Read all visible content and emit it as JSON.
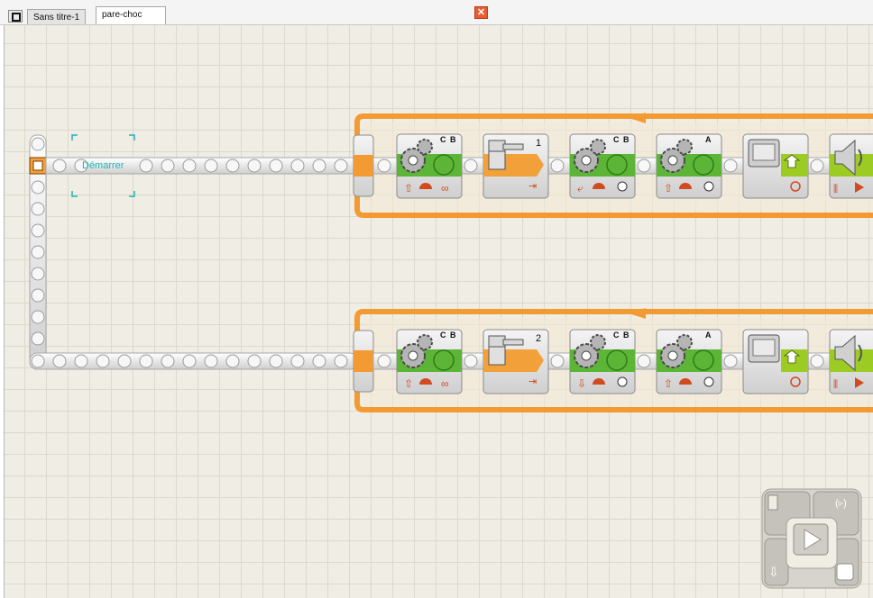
{
  "tabs": [
    {
      "label": "Sans titre-1"
    },
    {
      "label": "pare-choc"
    }
  ],
  "comment": {
    "text": "Démarrer"
  },
  "row1": {
    "motor1_ports": "C B",
    "sensor_port": "1",
    "motor2_ports": "C B",
    "motor3_ports": "A"
  },
  "row2": {
    "motor1_ports": "C B",
    "sensor_port": "2",
    "motor2_ports": "C B",
    "motor3_ports": "A"
  },
  "icons": {
    "home": "home-icon",
    "close": "close-icon",
    "motor": "gear-icon",
    "touch": "touch-sensor-icon",
    "display": "display-icon",
    "sound": "speaker-icon",
    "controller": "controller-icon"
  },
  "colors": {
    "loop": "#f39a32",
    "motor": "#5db537",
    "display": "#9ccb24",
    "sensor": "#f2a03a",
    "accent_comment": "#1fb5b5"
  }
}
